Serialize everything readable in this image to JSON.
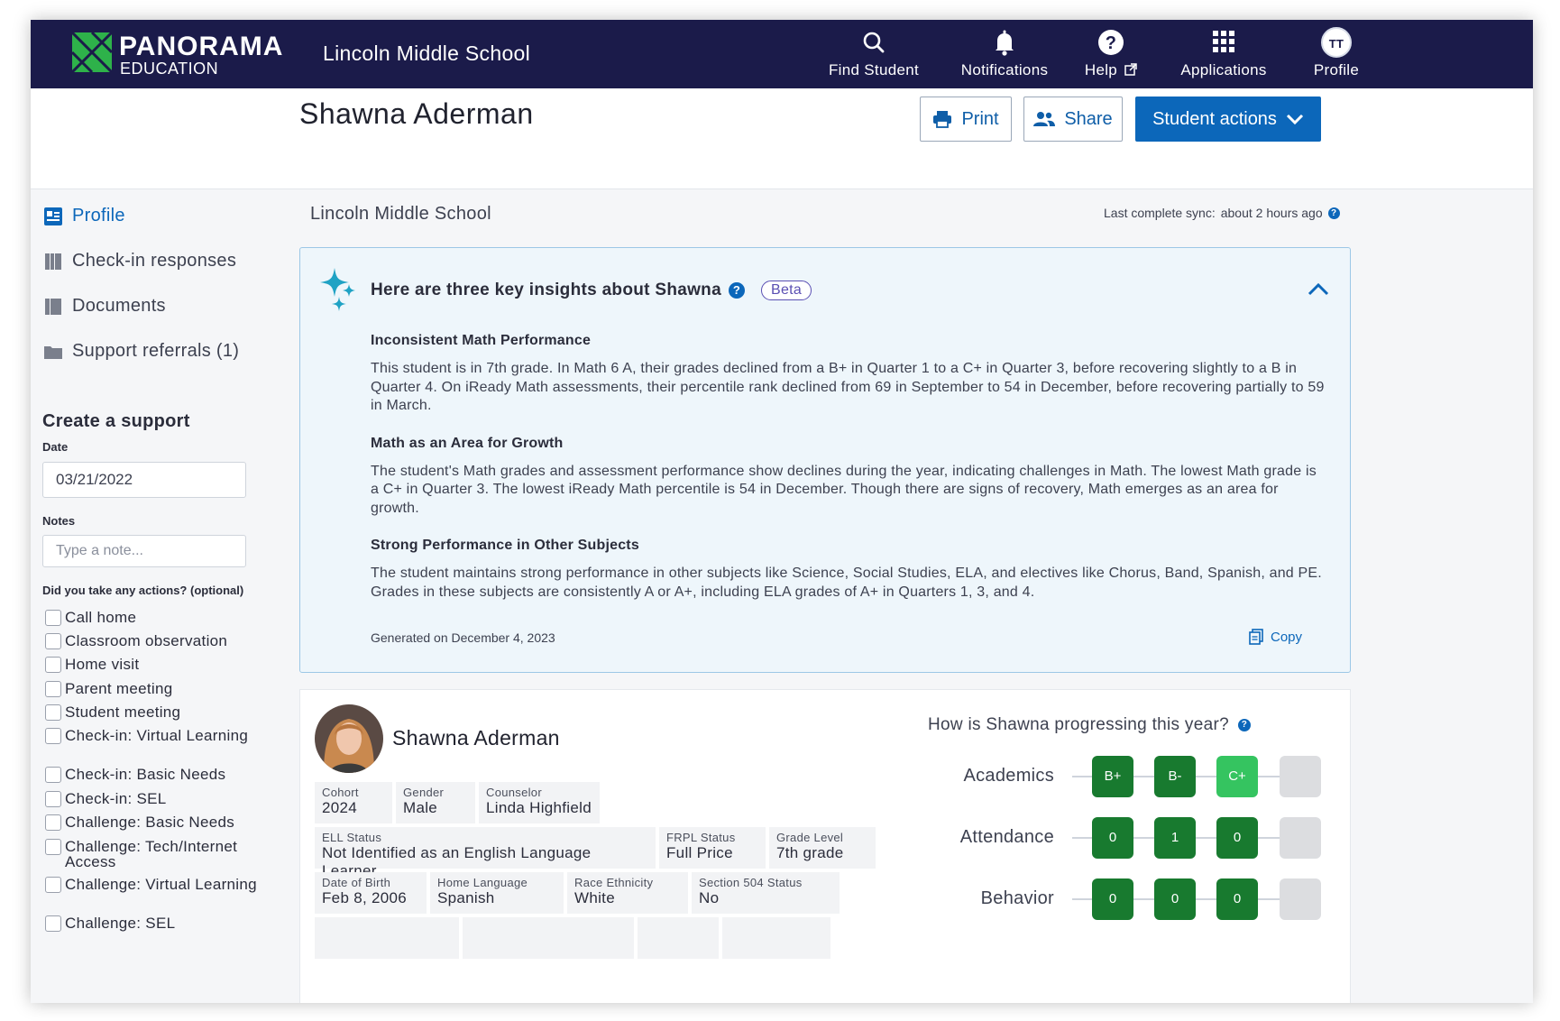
{
  "brand": {
    "name": "PANORAMA",
    "sub": "EDUCATION"
  },
  "topbar": {
    "school": "Lincoln Middle School",
    "nav": {
      "find": "Find Student",
      "notifications": "Notifications",
      "help": "Help",
      "applications": "Applications",
      "profile": "Profile",
      "avatar_initials": "TT"
    }
  },
  "header": {
    "title": "Shawna Aderman",
    "print": "Print",
    "share": "Share",
    "actions": "Student actions"
  },
  "sidebar": {
    "links": {
      "profile": "Profile",
      "checkin": "Check-in responses",
      "documents": "Documents",
      "referrals": "Support referrals (1)"
    },
    "create_title": "Create a support",
    "date_label": "Date",
    "date_value": "03/21/2022",
    "notes_label": "Notes",
    "notes_placeholder": "Type a note...",
    "actions_label": "Did you take any actions? (optional)",
    "actions": [
      "Call home",
      "Classroom observation",
      "Home visit",
      "Parent meeting",
      "Student meeting",
      "Check-in: Virtual Learning",
      "Check-in: Basic Needs",
      "Check-in: SEL",
      "Challenge: Basic Needs",
      "Challenge: Tech/Internet Access",
      "Challenge: Virtual Learning",
      "Challenge: SEL"
    ]
  },
  "main": {
    "school": "Lincoln Middle School",
    "sync_label": "Last complete sync:",
    "sync_value": "about 2 hours ago"
  },
  "insights": {
    "title": "Here are three key insights about Shawna",
    "badge": "Beta",
    "items": [
      {
        "heading": "Inconsistent Math Performance",
        "text": "This student is in 7th grade. In Math 6 A, their grades declined from a B+ in Quarter 1 to a C+ in Quarter 3, before recovering slightly to a B in Quarter 4. On iReady Math assessments, their percentile rank declined from 69 in September to 54 in December, before recovering partially to 59 in March."
      },
      {
        "heading": "Math as an Area for Growth",
        "text": "The student's Math grades and assessment performance show declines during the year, indicating challenges in Math. The lowest Math grade is a C+ in Quarter 3. The lowest iReady Math percentile is 54 in December. Though there are signs of recovery, Math emerges as an area for growth."
      },
      {
        "heading": "Strong Performance in Other Subjects",
        "text": "The student maintains strong performance in other subjects like Science, Social Studies, ELA, and electives like Chorus, Band, Spanish, and PE. Grades in these subjects are consistently A or A+, including ELA grades of A+ in Quarters 1, 3, and 4."
      }
    ],
    "generated": "Generated on December 4, 2023",
    "copy": "Copy"
  },
  "student": {
    "name": "Shawna Aderman",
    "attributes": {
      "cohort": {
        "k": "Cohort",
        "v": "2024"
      },
      "gender": {
        "k": "Gender",
        "v": "Male"
      },
      "counselor": {
        "k": "Counselor",
        "v": "Linda Highfield"
      },
      "ell": {
        "k": "ELL Status",
        "v": "Not Identified as an English Language Learner"
      },
      "frpl": {
        "k": "FRPL Status",
        "v": "Full Price"
      },
      "grade": {
        "k": "Grade Level",
        "v": "7th grade"
      },
      "dob": {
        "k": "Date of Birth",
        "v": "Feb 8, 2006"
      },
      "language": {
        "k": "Home Language",
        "v": "Spanish"
      },
      "race": {
        "k": "Race Ethnicity",
        "v": "White"
      },
      "s504": {
        "k": "Section 504 Status",
        "v": "No"
      }
    }
  },
  "progress": {
    "title": "How is Shawna progressing this year?",
    "rows": [
      {
        "label": "Academics",
        "values": [
          "B+",
          "B-",
          "C+",
          ""
        ]
      },
      {
        "label": "Attendance",
        "values": [
          "0",
          "1",
          "0",
          ""
        ]
      },
      {
        "label": "Behavior",
        "values": [
          "0",
          "0",
          "0",
          ""
        ]
      }
    ]
  },
  "colors": {
    "navy": "#1b1b4a",
    "accent_blue": "#0c67ba",
    "pill_dark_green": "#187a2f",
    "pill_light_green": "#35c460",
    "logo_green": "#2eb24a"
  }
}
